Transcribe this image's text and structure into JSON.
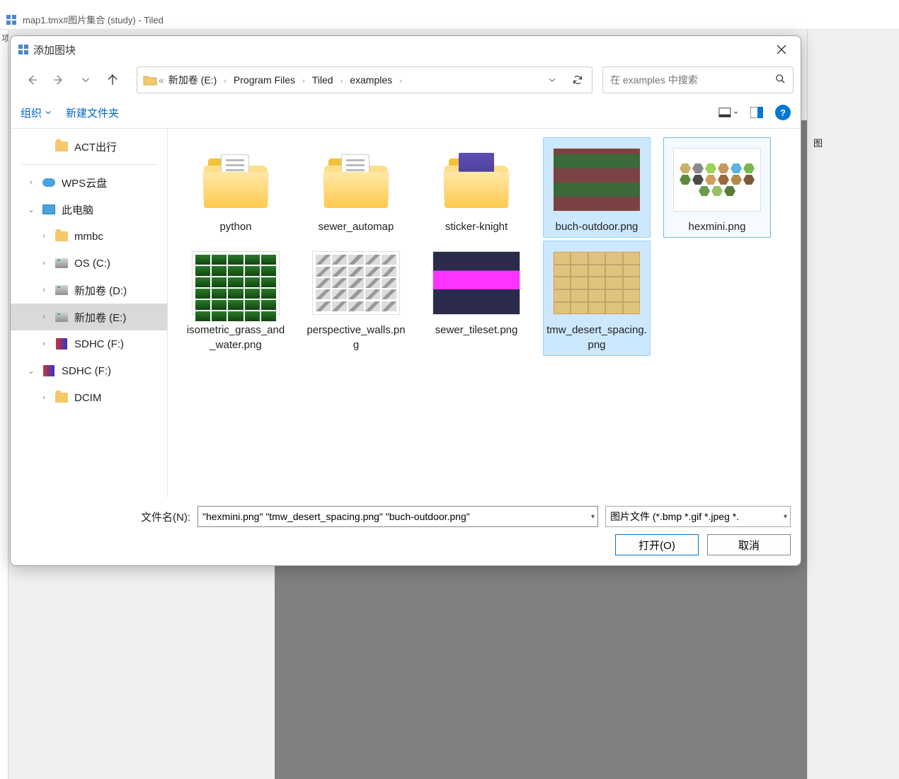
{
  "app": {
    "title": "map1.tmx#图片集合 (study) - Tiled",
    "left_panel_glyph": "项",
    "right_panel_label": "图"
  },
  "dialog": {
    "title": "添加图块",
    "breadcrumb": {
      "double_chevron": "«",
      "items": [
        "新加卷 (E:)",
        "Program Files",
        "Tiled",
        "examples"
      ]
    },
    "search": {
      "placeholder": "在 examples 中搜索"
    },
    "toolbar": {
      "organize": "组织",
      "new_folder": "新建文件夹"
    },
    "sidebar": [
      {
        "type": "item",
        "level": 1,
        "icon": "folder",
        "label": "ACT出行",
        "caret": ""
      },
      {
        "type": "sep"
      },
      {
        "type": "item",
        "level": 0,
        "icon": "cloud",
        "label": "WPS云盘",
        "caret": ">"
      },
      {
        "type": "item",
        "level": 0,
        "icon": "pc",
        "label": "此电脑",
        "caret": "v"
      },
      {
        "type": "item",
        "level": 1,
        "icon": "folder",
        "label": "mmbc",
        "caret": ">"
      },
      {
        "type": "item",
        "level": 1,
        "icon": "disk",
        "label": "OS (C:)",
        "caret": ">"
      },
      {
        "type": "item",
        "level": 1,
        "icon": "disk",
        "label": "新加卷 (D:)",
        "caret": ">"
      },
      {
        "type": "item",
        "level": 1,
        "icon": "disk",
        "label": "新加卷 (E:)",
        "caret": ">",
        "selected": true
      },
      {
        "type": "item",
        "level": 1,
        "icon": "sd",
        "label": "SDHC (F:)",
        "caret": ">"
      },
      {
        "type": "item",
        "level": 0,
        "icon": "sd",
        "label": "SDHC (F:)",
        "caret": "v"
      },
      {
        "type": "item",
        "level": 1,
        "icon": "folder",
        "label": "DCIM",
        "caret": ">"
      }
    ],
    "files": [
      {
        "name": "python",
        "kind": "folder",
        "state": ""
      },
      {
        "name": "sewer_automap",
        "kind": "folder",
        "state": ""
      },
      {
        "name": "sticker-knight",
        "kind": "folder-img",
        "thumb": "sticker",
        "state": ""
      },
      {
        "name": "buch-outdoor.png",
        "kind": "image",
        "thumb": "buch",
        "state": "selected"
      },
      {
        "name": "hexmini.png",
        "kind": "image",
        "thumb": "hex",
        "state": "focused"
      },
      {
        "name": "isometric_grass_and_water.png",
        "kind": "image",
        "thumb": "grass",
        "state": ""
      },
      {
        "name": "perspective_walls.png",
        "kind": "image",
        "thumb": "persp",
        "state": ""
      },
      {
        "name": "sewer_tileset.png",
        "kind": "image",
        "thumb": "sewer",
        "state": ""
      },
      {
        "name": "tmw_desert_spacing.png",
        "kind": "image",
        "thumb": "desert",
        "state": "selected"
      }
    ],
    "footer": {
      "filename_label": "文件名(N):",
      "filename_value": "\"hexmini.png\" \"tmw_desert_spacing.png\" \"buch-outdoor.png\"",
      "filetype_value": "图片文件 (*.bmp *.gif *.jpeg *.",
      "open": "打开(O)",
      "cancel": "取消"
    }
  }
}
